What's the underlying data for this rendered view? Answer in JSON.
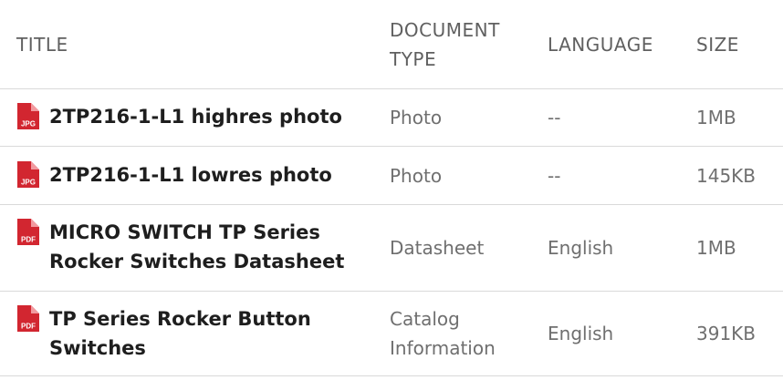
{
  "table": {
    "headers": {
      "title": "TITLE",
      "doc_type": "DOCUMENT\nTYPE",
      "language": "LANGUAGE",
      "size": "SIZE"
    },
    "rows": [
      {
        "file_type": "JPG",
        "icon": "jpg-file-icon",
        "title": "2TP216-1-L1 highres photo",
        "doc_type": "Photo",
        "language": "--",
        "size": "1MB"
      },
      {
        "file_type": "JPG",
        "icon": "jpg-file-icon",
        "title": "2TP216-1-L1 lowres photo",
        "doc_type": "Photo",
        "language": "--",
        "size": "145KB"
      },
      {
        "file_type": "PDF",
        "icon": "pdf-file-icon",
        "title": "MICRO SWITCH TP Series Rocker Switches Datasheet",
        "doc_type": "Datasheet",
        "language": "English",
        "size": "1MB"
      },
      {
        "file_type": "PDF",
        "icon": "pdf-file-icon",
        "title": "TP Series Rocker Button Switches",
        "doc_type": "Catalog Information",
        "language": "English",
        "size": "391KB"
      }
    ]
  },
  "colors": {
    "icon_red": "#d22630",
    "title_text": "#1e1e1e",
    "cell_text": "#6f6f6f",
    "divider": "#d9d9d9"
  }
}
